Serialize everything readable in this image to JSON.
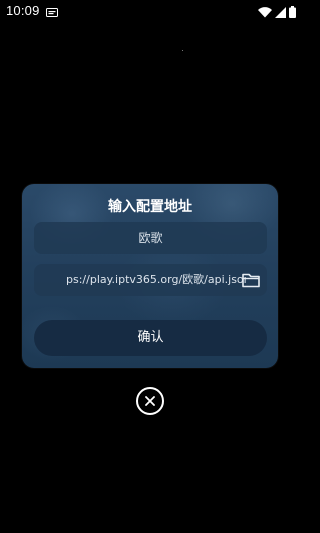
{
  "status_bar": {
    "time": "10:09",
    "icons": [
      "notification-icon",
      "wifi-icon",
      "cell-signal-icon",
      "battery-icon"
    ]
  },
  "dialog": {
    "title": "输入配置地址",
    "name_field": {
      "value": "欧歌"
    },
    "url_field": {
      "value": "ps://play.iptv365.org/欧歌/api.json",
      "icon": "folder-icon"
    },
    "confirm_label": "确认"
  },
  "close_button": {
    "icon": "close-icon"
  },
  "colors": {
    "background": "#000000",
    "dialog": "#23405d",
    "field": "#203a54",
    "button": "#162b43",
    "text": "#ffffff"
  }
}
